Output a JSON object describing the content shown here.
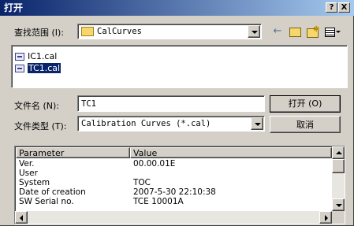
{
  "window": {
    "title": "打开",
    "help_label": "?",
    "close_label": "X"
  },
  "lookin": {
    "label": "查找范围 (I):",
    "value": "CalCurves"
  },
  "files": [
    {
      "name": "IC1.cal"
    },
    {
      "name": "TC1.cal"
    }
  ],
  "filename": {
    "label": "文件名 (N):",
    "value": "TC1"
  },
  "filetype": {
    "label": "文件类型 (T):",
    "value": "Calibration Curves (*.cal)"
  },
  "buttons": {
    "open": "打开 (O)",
    "cancel": "取消"
  },
  "details": {
    "columns": [
      "Parameter",
      "Value"
    ],
    "rows": [
      {
        "param": "Ver.",
        "value": "00.00.01E"
      },
      {
        "param": "User",
        "value": ""
      },
      {
        "param": "System",
        "value": "TOC"
      },
      {
        "param": "Date of creation",
        "value": "2007-5-30 22:10:38"
      },
      {
        "param": "SW Serial no.",
        "value": "TCE 10001A"
      }
    ]
  }
}
